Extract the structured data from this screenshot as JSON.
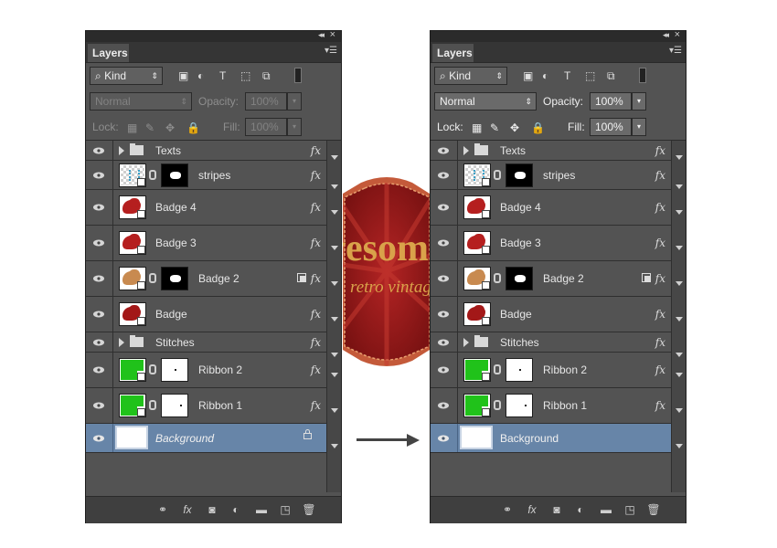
{
  "panels": [
    {
      "tab_label": "Layers",
      "kind_label": "Kind",
      "blend_mode": "Normal",
      "opacity_label": "Opacity:",
      "opacity_value": "100%",
      "lock_label": "Lock:",
      "fill_label": "Fill:",
      "fill_value": "100%",
      "enabled": false,
      "layers": [
        {
          "name": "Texts",
          "type": "group",
          "fx": "fx"
        },
        {
          "name": "stripes",
          "type": "pattern",
          "fx": "fx"
        },
        {
          "name": "Badge 4",
          "type": "badge",
          "color": "#b51f1f",
          "fx": "fx"
        },
        {
          "name": "Badge 3",
          "type": "badge",
          "color": "#b51f1f",
          "fx": "fx"
        },
        {
          "name": "Badge 2",
          "type": "badge-mask",
          "color": "#c88a50",
          "fx": "fx"
        },
        {
          "name": "Badge",
          "type": "badge",
          "color": "#a31818",
          "fx": "fx"
        },
        {
          "name": "Stitches",
          "type": "group",
          "fx": "fx"
        },
        {
          "name": "Ribbon 2",
          "type": "ribbon",
          "fx": "fx"
        },
        {
          "name": "Ribbon 1",
          "type": "ribbon",
          "fx": "fx"
        },
        {
          "name": "Background",
          "type": "background",
          "italic": true
        }
      ]
    },
    {
      "tab_label": "Layers",
      "kind_label": "Kind",
      "blend_mode": "Normal",
      "opacity_label": "Opacity:",
      "opacity_value": "100%",
      "lock_label": "Lock:",
      "fill_label": "Fill:",
      "fill_value": "100%",
      "enabled": true,
      "layers": [
        {
          "name": "Texts",
          "type": "group",
          "fx": "fx"
        },
        {
          "name": "stripes",
          "type": "pattern",
          "fx": "fx"
        },
        {
          "name": "Badge 4",
          "type": "badge",
          "color": "#b51f1f",
          "fx": "fx"
        },
        {
          "name": "Badge 3",
          "type": "badge",
          "color": "#b51f1f",
          "fx": "fx"
        },
        {
          "name": "Badge 2",
          "type": "badge-mask",
          "color": "#c88a50",
          "fx": "fx"
        },
        {
          "name": "Badge",
          "type": "badge",
          "color": "#a31818",
          "fx": "fx"
        },
        {
          "name": "Stitches",
          "type": "group",
          "fx": "fx"
        },
        {
          "name": "Ribbon 2",
          "type": "ribbon",
          "fx": "fx"
        },
        {
          "name": "Ribbon 1",
          "type": "ribbon",
          "fx": "fx"
        },
        {
          "name": "Background",
          "type": "background",
          "italic": false
        }
      ]
    }
  ],
  "badge_preview": {
    "big_text": "vesom",
    "small_text": "retro vintag",
    "colors": {
      "badge": "#a31f1f",
      "text": "#d9a24a",
      "border": "#c45a3a"
    }
  },
  "colors": {
    "panel_bg": "#535353",
    "selected_layer": "#6785a8",
    "ribbon_green": "#20c21a"
  }
}
